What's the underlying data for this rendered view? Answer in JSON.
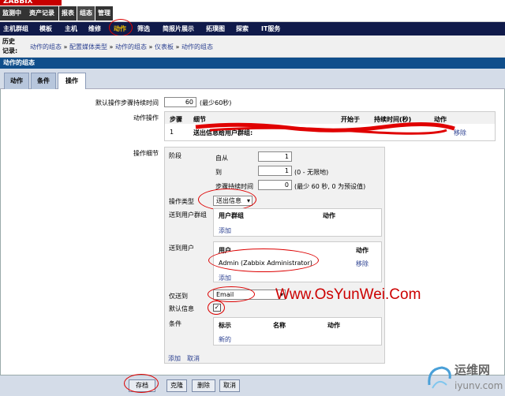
{
  "logo": "ZABBIX",
  "main_tabs": [
    "监测中",
    "资产记录",
    "报表",
    "组态",
    "管理"
  ],
  "sub_nav": [
    "主机群组",
    "模板",
    "主机",
    "维修",
    "动作",
    "筛选",
    "简报片展示",
    "拓璞图",
    "探索",
    "IT服务"
  ],
  "history": {
    "label": "历史记录:",
    "items": [
      "动作的组态",
      "配置媒体类型",
      "动作的组态",
      "仪表板",
      "动作的组态"
    ],
    "sep": "»"
  },
  "section_title": "动作的组态",
  "tabs": [
    "动作",
    "条件",
    "操作"
  ],
  "form": {
    "default_step_label": "默认操作步骤持续时间",
    "default_step_value": "60",
    "default_step_hint": "(最少60秒)",
    "ops_label": "动作操作",
    "ops_headers": [
      "步骤",
      "细节",
      "开始于",
      "持续时间(秒)",
      "动作"
    ],
    "ops_row": {
      "step": "1",
      "detail": "送出信息给用户群组:",
      "action": "移除"
    },
    "op_details_label": "操作细节",
    "stage_label": "阶段",
    "from_label": "自从",
    "from_value": "1",
    "to_label": "到",
    "to_value": "1",
    "to_hint": "(0 - 无限地)",
    "step_dur_label": "步骤持续时间",
    "step_dur_value": "0",
    "step_dur_hint": "(最少 60 秒, 0 为预设值)",
    "op_type_label": "操作类型",
    "op_type_value": "送出信息",
    "send_groups_label": "送到用户群组",
    "groups_header": "用户群组",
    "groups_action": "动作",
    "groups_add": "添加",
    "send_users_label": "送到用户",
    "users_header": "用户",
    "users_action": "动作",
    "user_name": "Admin (Zabbix Administrator)",
    "user_remove": "移除",
    "users_add": "添加",
    "send_only_label": "仅送到",
    "send_only_value": "Email",
    "default_msg_label": "默认信息",
    "conditions_label": "条件",
    "cond_headers": [
      "标示",
      "名称",
      "动作"
    ],
    "cond_new": "新的",
    "add": "添加",
    "cancel": "取消"
  },
  "footer_buttons": [
    "存档",
    "克隆",
    "删除",
    "取消"
  ],
  "watermark": "Www.OsYunWei.Com",
  "watermark2": {
    "cn": "运维网",
    "url": "iyunv.com"
  }
}
